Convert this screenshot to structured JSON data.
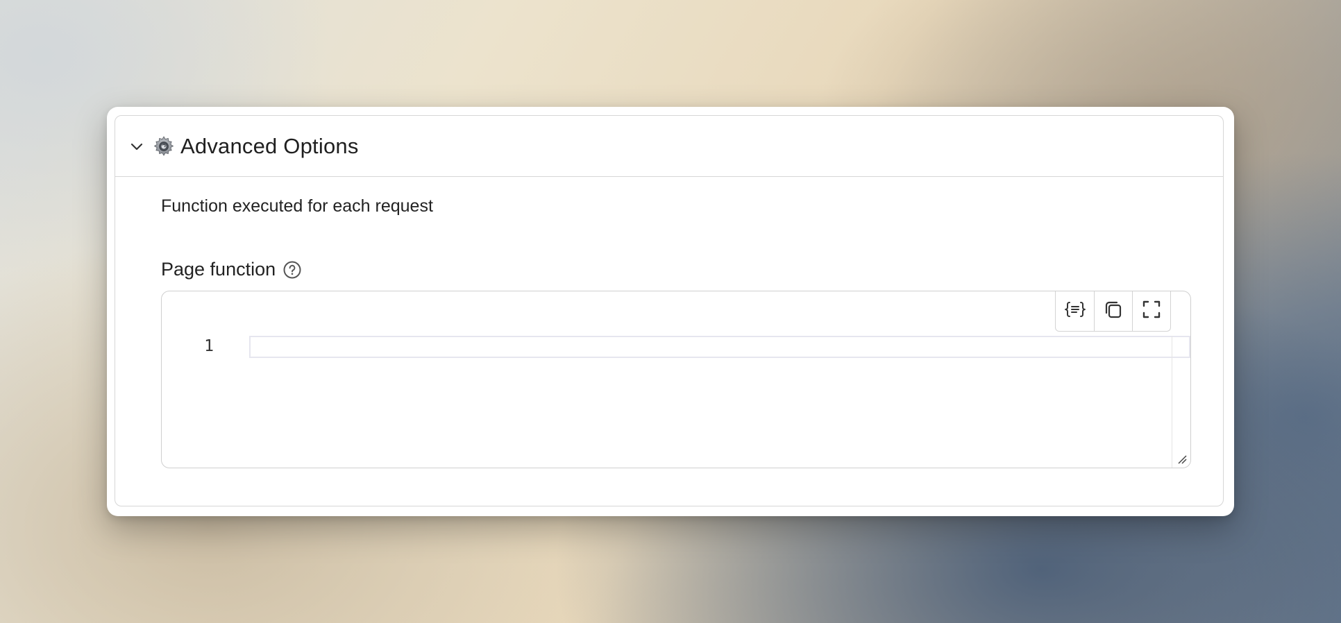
{
  "panel": {
    "title": "Advanced Options",
    "toggle_icon": "chevron-down-icon",
    "title_icon": "gear-icon"
  },
  "section": {
    "description": "Function executed for each request"
  },
  "field": {
    "label": "Page function",
    "help_icon": "question-circle-icon"
  },
  "editor": {
    "line_numbers": [
      "1"
    ],
    "content": "",
    "toolbar": [
      {
        "name": "format-code-button",
        "icon": "braces-format-icon"
      },
      {
        "name": "copy-button",
        "icon": "copy-icon"
      },
      {
        "name": "fullscreen-button",
        "icon": "fullscreen-icon"
      }
    ]
  },
  "colors": {
    "border": "#d6d6d6",
    "text": "#222222",
    "active_line_border": "#e6e6ef"
  }
}
